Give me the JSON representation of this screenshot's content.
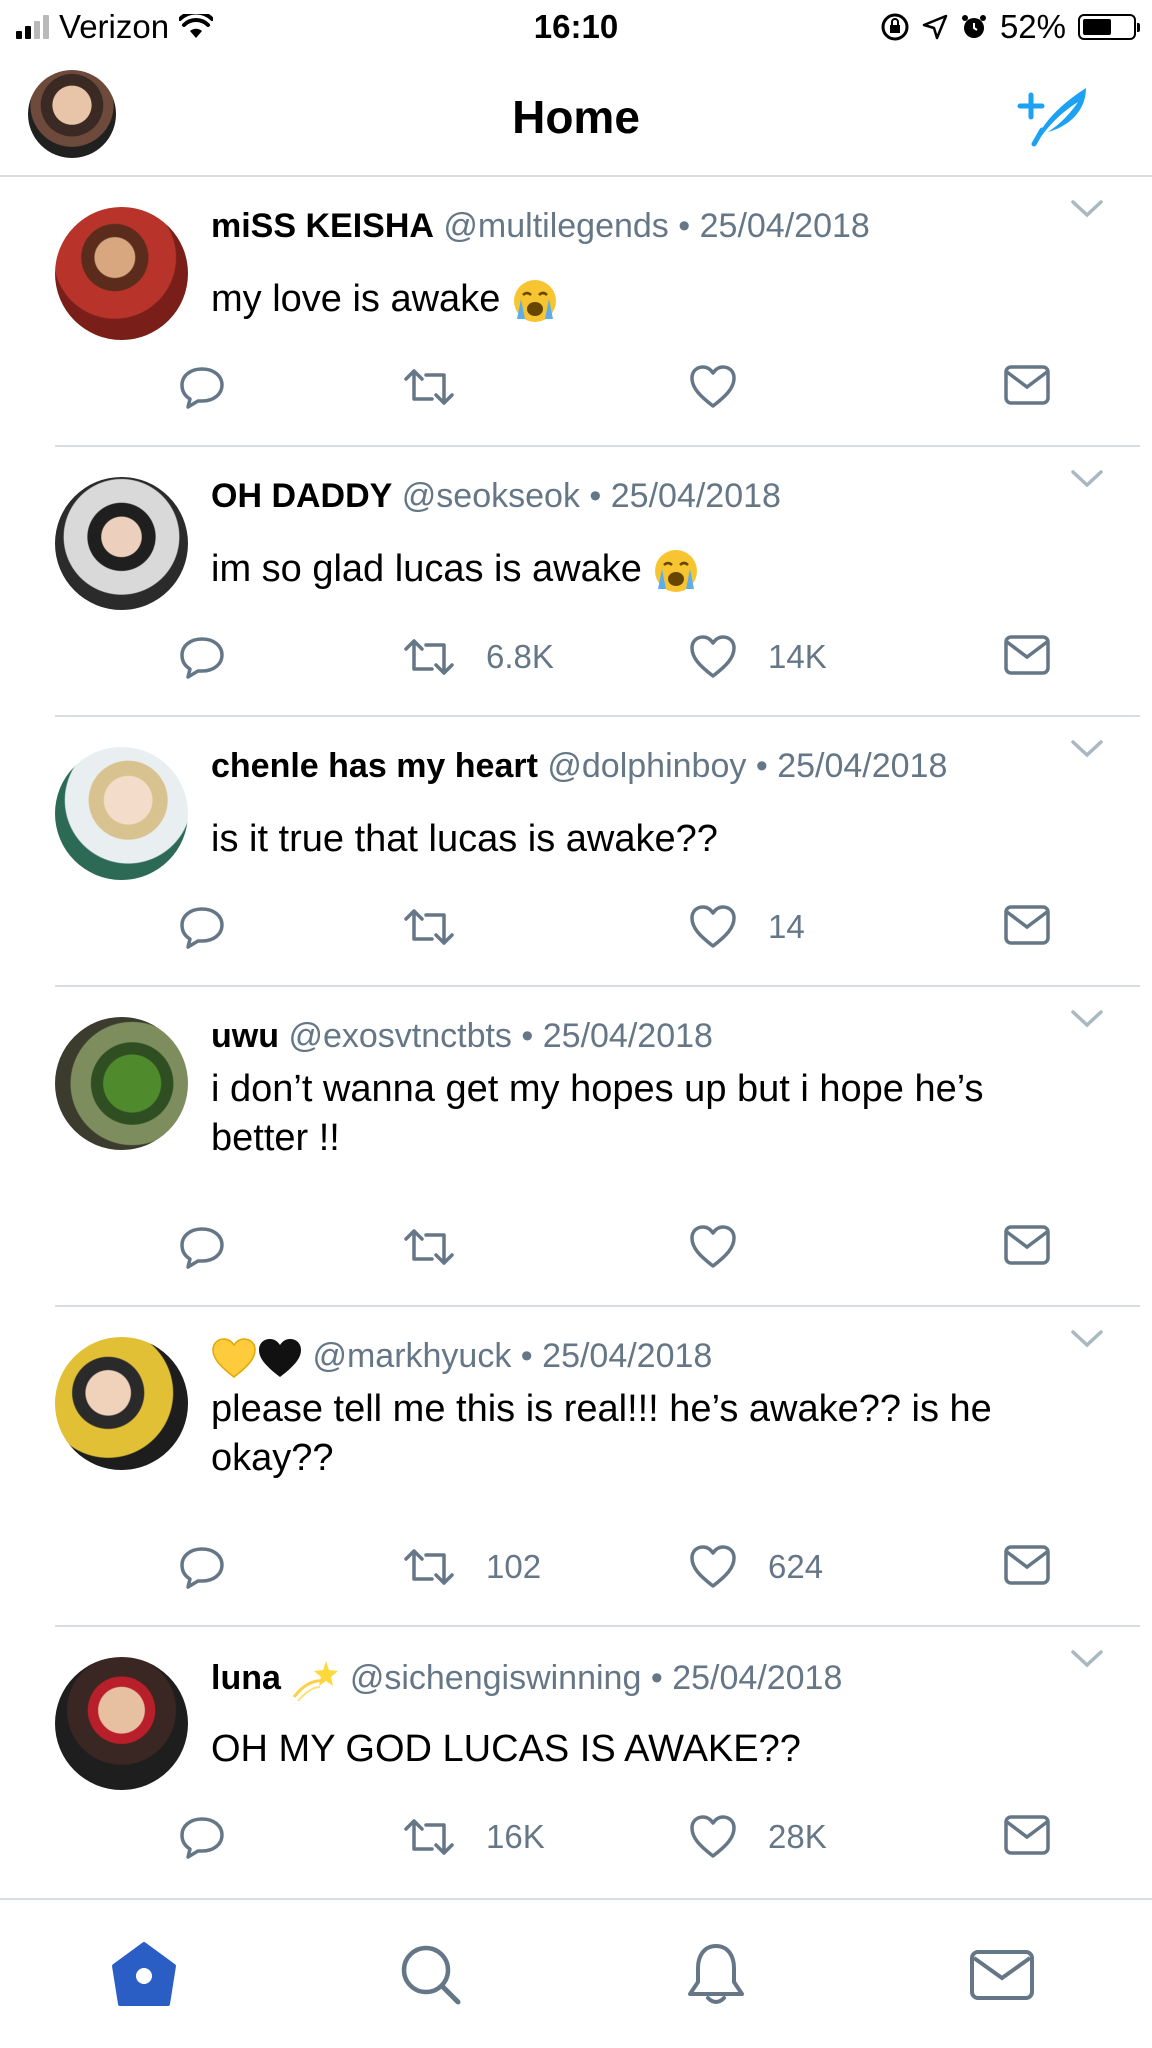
{
  "status_bar": {
    "carrier": "Verizon",
    "time": "16:10",
    "battery": "52%"
  },
  "header": {
    "title": "Home"
  },
  "colors": {
    "accent": "#1da1f2",
    "nav_active": "#2b5ec4",
    "icon_gray": "#657786",
    "divider": "#d8dde2"
  },
  "tweets": [
    {
      "name": "miSS KEISHA",
      "handle": "@multilegends",
      "sep": "•",
      "date": "25/04/2018",
      "text": "my love is awake",
      "emoji": "crying-face",
      "retweets": "",
      "likes": ""
    },
    {
      "name": "OH DADDY",
      "handle": "@seokseok",
      "sep": "•",
      "date": "25/04/2018",
      "text": "im so glad lucas is awake",
      "emoji": "crying-face",
      "retweets": "6.8K",
      "likes": "14K"
    },
    {
      "name": "chenle has my heart",
      "handle": "@dolphinboy",
      "sep": "•",
      "date": "25/04/2018",
      "text": "is it true that lucas is awake??",
      "emoji": "",
      "retweets": "",
      "likes": "14"
    },
    {
      "name": "uwu",
      "handle": "@exosvtnctbts",
      "sep": "•",
      "date": "25/04/2018",
      "text": "i don’t wanna get my hopes up but i hope he’s better !!",
      "emoji": "",
      "retweets": "",
      "likes": ""
    },
    {
      "name": "",
      "name_emoji": [
        "yellow-heart",
        "black-heart"
      ],
      "handle": "@markhyuck",
      "sep": "•",
      "date": "25/04/2018",
      "text": "please tell me this is real!!! he’s awake?? is he okay??",
      "emoji": "",
      "retweets": "102",
      "likes": "624"
    },
    {
      "name": "luna",
      "name_emoji": [
        "dizzy"
      ],
      "handle": "@sichengiswinning",
      "sep": "•",
      "date": "25/04/2018",
      "text": "OH MY GOD LUCAS IS AWAKE??",
      "emoji": "",
      "retweets": "16K",
      "likes": "28K"
    }
  ],
  "icons": [
    "reply-icon",
    "retweet-icon",
    "like-icon",
    "dm-icon",
    "home-icon",
    "search-icon",
    "notifications-icon",
    "messages-icon",
    "compose-icon",
    "caret-down-icon"
  ]
}
